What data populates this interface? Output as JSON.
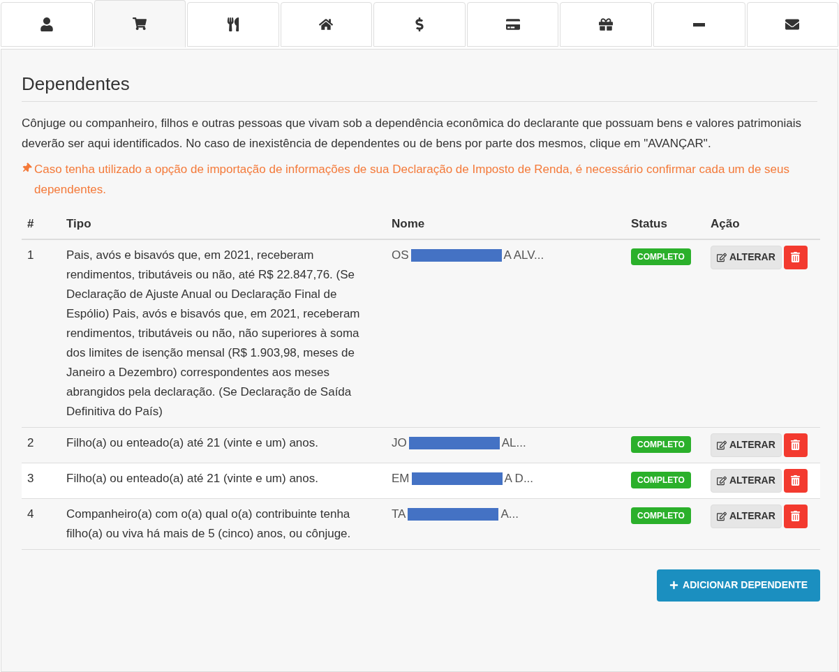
{
  "tabs": [
    {
      "kind": "user",
      "selected": false
    },
    {
      "kind": "cart",
      "selected": true
    },
    {
      "kind": "cutlery",
      "selected": false
    },
    {
      "kind": "home",
      "selected": false
    },
    {
      "kind": "dollar",
      "selected": false
    },
    {
      "kind": "card",
      "selected": false
    },
    {
      "kind": "gift",
      "selected": false
    },
    {
      "kind": "minus",
      "selected": false
    },
    {
      "kind": "envelope",
      "selected": false
    }
  ],
  "heading": "Dependentes",
  "description": "Cônjuge ou companheiro, filhos e outras pessoas que vivam sob a dependência econômica do declarante que possuam bens e valores patrimoniais deverão ser aqui identificados. No caso de inexistência de dependentes ou de bens por parte dos mesmos, clique em \"AVANÇAR\".",
  "warning": "Caso tenha utilizado a opção de importação de informações de sua Declaração de Imposto de Renda, é necessário confirmar cada um de seus dependentes.",
  "table": {
    "columns": [
      "#",
      "Tipo",
      "Nome",
      "Status",
      "Ação"
    ],
    "rows": [
      {
        "number": "1",
        "tipo": "Pais, avós e bisavós que, em 2021, receberam rendimentos, tributáveis ou não, até R$ 22.847,76. (Se Declaração de Ajuste Anual ou Declaração Final de Espólio) Pais, avós e bisavós que, em 2021, receberam rendimentos, tributáveis ou não, não superiores à soma dos limites de isenção mensal (R$ 1.903,98, meses de Janeiro a Dezembro) correspondentes aos meses abrangidos pela declaração. (Se Declaração de Saída Definitiva do País)",
        "name_start": "OS",
        "name_end": "A ALV...",
        "status": "COMPLETO",
        "edit": "ALTERAR"
      },
      {
        "number": "2",
        "tipo": "Filho(a) ou enteado(a) até 21 (vinte e um) anos.",
        "name_start": "JO",
        "name_end": "AL...",
        "status": "COMPLETO",
        "edit": "ALTERAR"
      },
      {
        "number": "3",
        "tipo": "Filho(a) ou enteado(a) até 21 (vinte e um) anos.",
        "name_start": "EM",
        "name_end": "A D...",
        "status": "COMPLETO",
        "edit": "ALTERAR"
      },
      {
        "number": "4",
        "tipo": "Companheiro(a) com o(a) qual o(a) contribuinte tenha filho(a) ou viva há mais de 5 (cinco) anos, ou cônjuge.",
        "name_start": "TA",
        "name_end": "A...",
        "status": "COMPLETO",
        "edit": "ALTERAR"
      }
    ]
  },
  "add_button": "ADICIONAR DEPENDENTE"
}
